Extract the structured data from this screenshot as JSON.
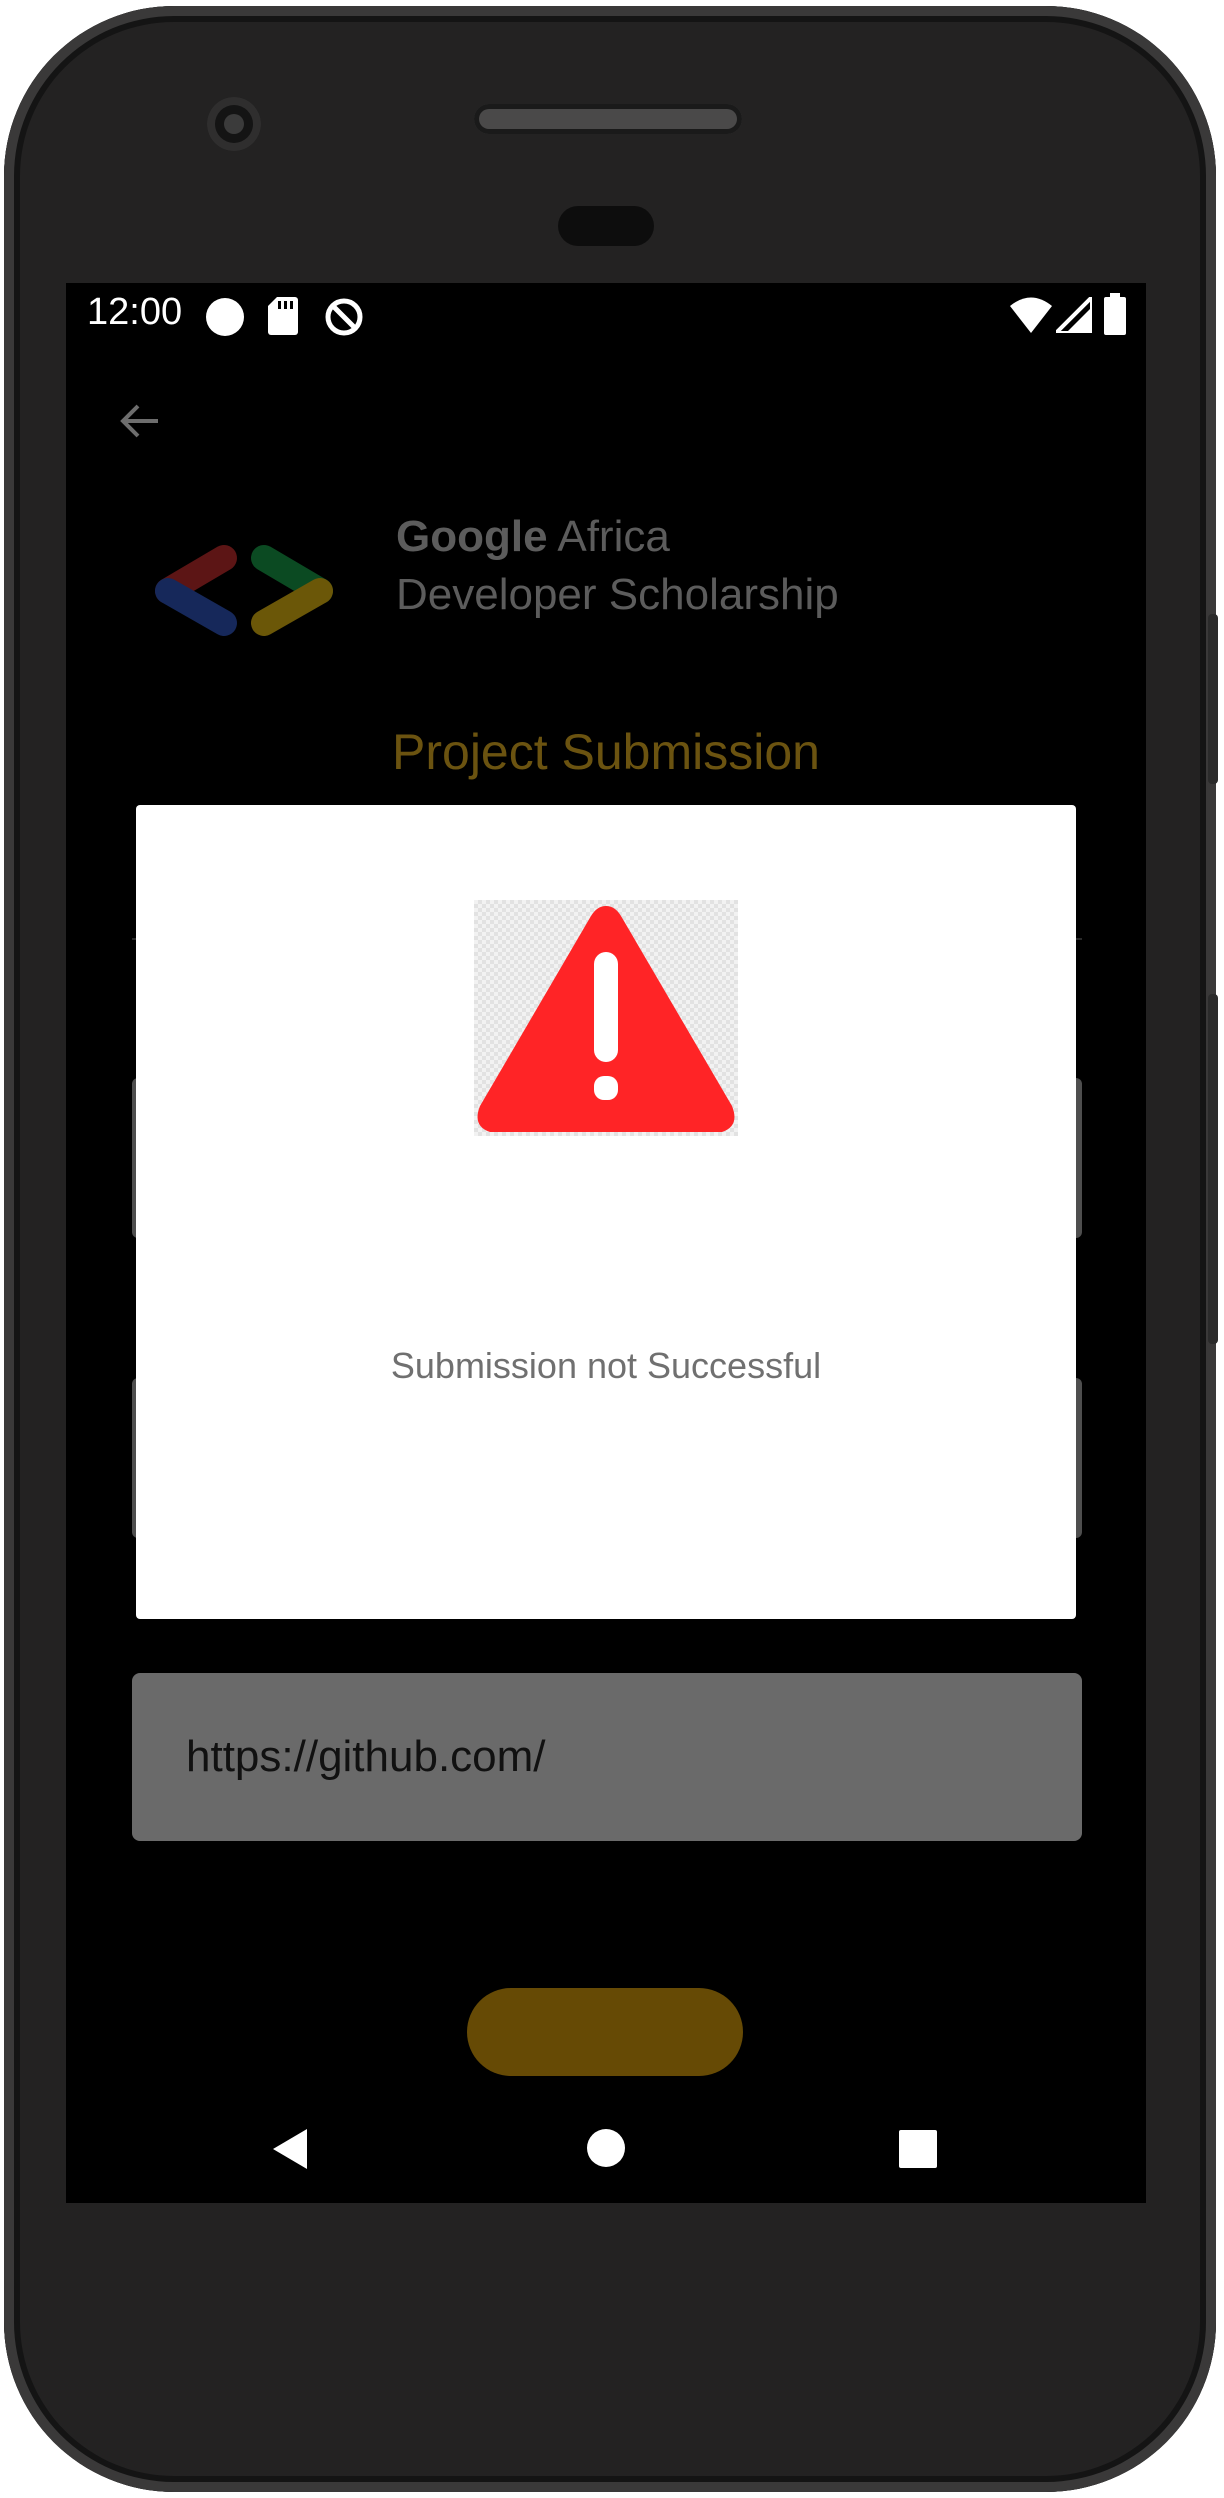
{
  "status_bar": {
    "time": "12:00",
    "icons": [
      "circle-notification-icon",
      "sd-card-icon",
      "do-not-disturb-icon",
      "wifi-icon",
      "cell-signal-icon",
      "battery-icon"
    ]
  },
  "header": {
    "back_icon": "arrow-back-icon",
    "brand_line1_bold": "Google",
    "brand_line1_rest": " Africa",
    "brand_line2": "Developer Scholarship"
  },
  "page": {
    "title": "Project Submission"
  },
  "form": {
    "github_link_value": "https://github.com/"
  },
  "dialog": {
    "icon": "warning-icon",
    "message": "Submission not Successful"
  },
  "navigation": {
    "icons": [
      "nav-back-icon",
      "nav-home-icon",
      "nav-recents-icon"
    ]
  },
  "colors": {
    "title": "#6b5310",
    "submit_button": "#664a05",
    "warning_red": "#ff2426",
    "field_overlay": "#6a6a6a",
    "dialog_background": "#ffffff"
  }
}
